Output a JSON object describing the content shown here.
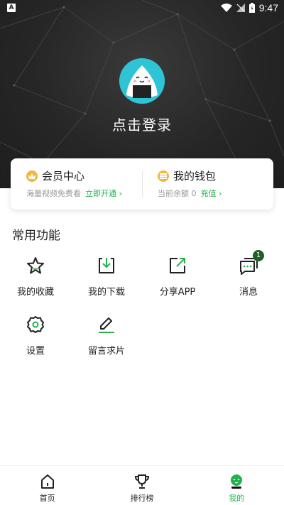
{
  "status_bar": {
    "time": "9:47",
    "notification_icon": "A"
  },
  "profile": {
    "login_text": "点击登录"
  },
  "member_card": {
    "title": "会员中心",
    "subtitle": "海量视频免费看",
    "action": "立即开通",
    "chevron": "›"
  },
  "wallet_card": {
    "title": "我的钱包",
    "subtitle": "当前余额 0",
    "action": "充值",
    "chevron": "›"
  },
  "functions": {
    "title": "常用功能",
    "items": [
      {
        "label": "我的收藏",
        "icon": "star-icon"
      },
      {
        "label": "我的下载",
        "icon": "download-icon"
      },
      {
        "label": "分享APP",
        "icon": "share-icon"
      },
      {
        "label": "消息",
        "icon": "message-icon",
        "badge": "1"
      },
      {
        "label": "设置",
        "icon": "gear-icon"
      },
      {
        "label": "留言求片",
        "icon": "edit-icon"
      }
    ]
  },
  "bottom_nav": {
    "items": [
      {
        "label": "首页",
        "icon": "home-icon"
      },
      {
        "label": "排行榜",
        "icon": "trophy-icon"
      },
      {
        "label": "我的",
        "icon": "profile-icon",
        "active": true
      }
    ]
  },
  "colors": {
    "accent": "#22b14c",
    "header_bg": "#262626",
    "avatar_bg": "#2ec4d6",
    "badge_bg": "#1f5f2b"
  }
}
